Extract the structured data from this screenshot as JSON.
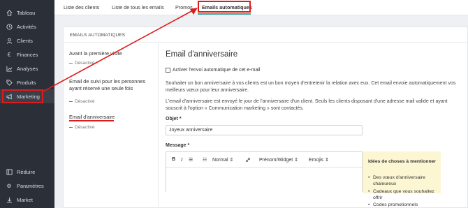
{
  "sidebar": {
    "items": [
      {
        "label": "Tableau",
        "icon": "home-icon"
      },
      {
        "label": "Activités",
        "icon": "activity-icon"
      },
      {
        "label": "Clients",
        "icon": "user-icon"
      },
      {
        "label": "Finances",
        "icon": "euro-icon"
      },
      {
        "label": "Analyses",
        "icon": "chart-icon"
      },
      {
        "label": "Produits",
        "icon": "tag-icon"
      },
      {
        "label": "Marketing",
        "icon": "megaphone-icon"
      }
    ],
    "bottom_items": [
      {
        "label": "Réduire",
        "icon": "collapse-icon"
      },
      {
        "label": "Paramètres",
        "icon": "gear-icon"
      },
      {
        "label": "Market",
        "icon": "download-icon"
      }
    ]
  },
  "tabs": [
    "Liste des clients",
    "Liste de tous les emails",
    "Promos",
    "Emails automatiques"
  ],
  "panel": {
    "header": "EMAILS AUTOMATIQUES",
    "items": [
      {
        "title": "Avant la première visite",
        "status": "Désactivé"
      },
      {
        "title": "Email de suivi pour les personnes ayant réservé une seule fois",
        "status": "Désactivé"
      },
      {
        "title": "Email d'anniversaire",
        "status": "Désactivé"
      }
    ]
  },
  "detail": {
    "title": "Email d'anniversaire",
    "checkbox_label": "Activer l'envoi automatique de cet e-mail",
    "para1": "Souhaiter un bon anniversaire à vos clients est un bon moyen d'entretenir la relation avec eux. Cet email envoie automatiquement vos meilleurs vœux pour leur anniversaire.",
    "para2": "L'email d'anniversaire est envoyé le jour de l'anniversaire d'un client. Seuls les clients disposant d'une adresse mail valide et ayant souscrit à l'option « Communication marketing » sont contactés.",
    "subject_label": "Objet *",
    "subject_value": "Joyeux anniversaire",
    "message_label": "Message *",
    "toolbar": {
      "bold": "B",
      "italic": "I",
      "list": "☰",
      "ordered_list": "☷",
      "style": "Normal",
      "link": "🔗",
      "widget": "Prénom/Widget",
      "emojis": "Emojis"
    },
    "ideas": {
      "title": "Idées de choses à mentionner",
      "items": [
        "Des vœux d'anniversaire chaleureux",
        "Cadeaux que vous souhaitez offrir",
        "Codes promotionnels"
      ]
    }
  },
  "colors": {
    "sidebar": "#2b2f38",
    "highlight": "#e01b1b",
    "accent": "#3aa7a3",
    "ideas_bg": "#fdf6d3"
  }
}
